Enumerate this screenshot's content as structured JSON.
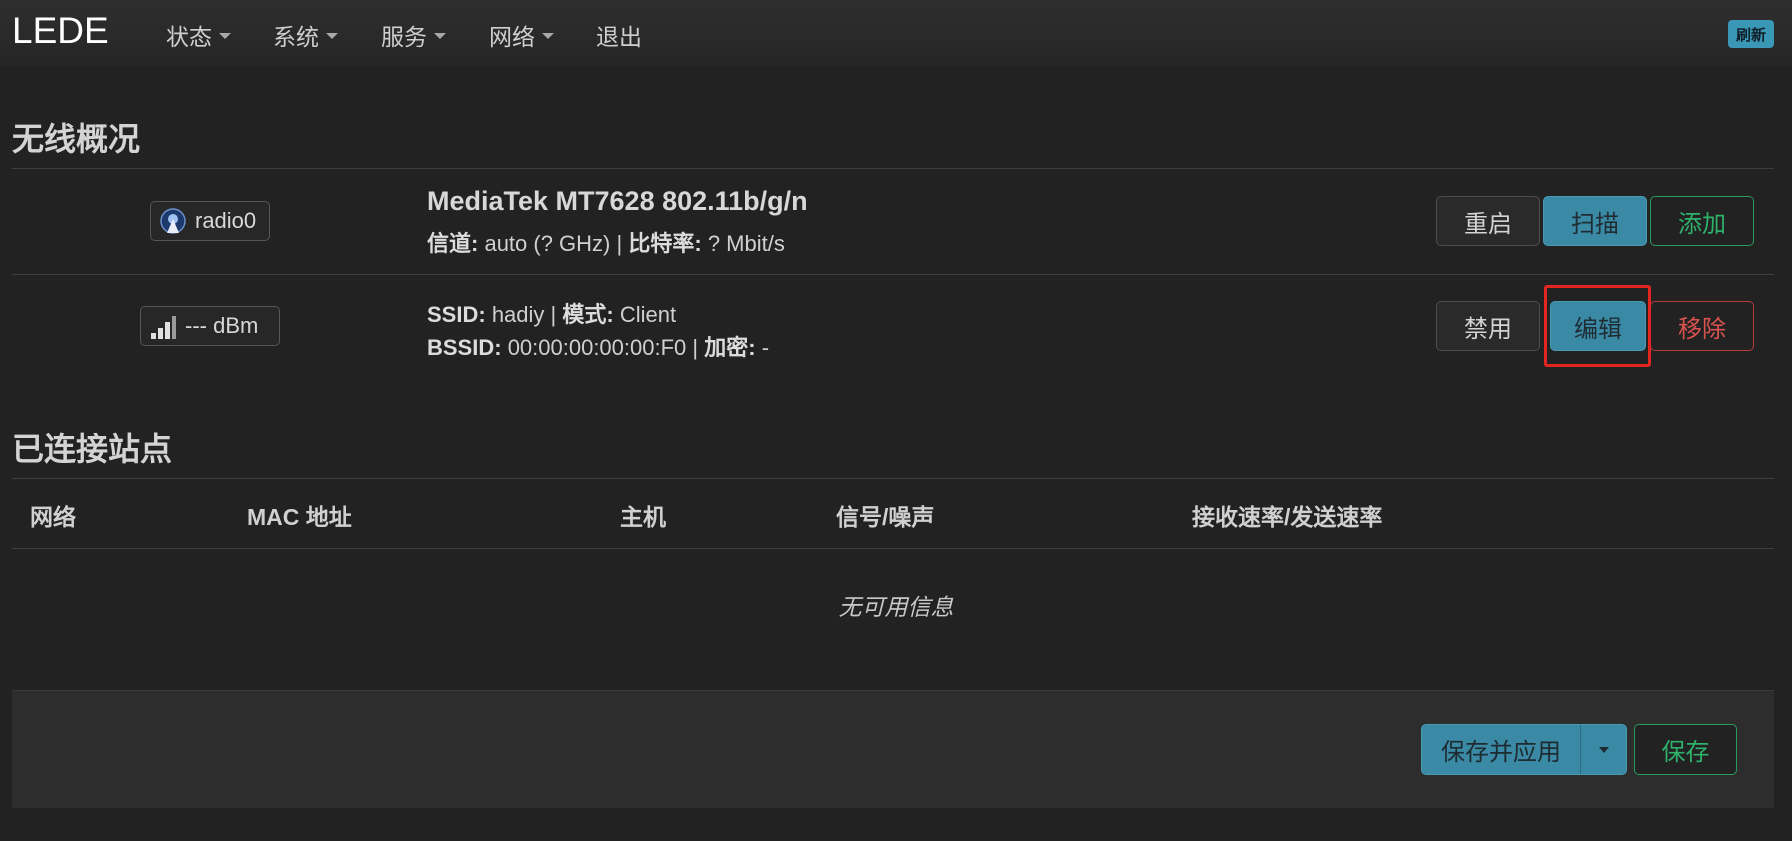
{
  "nav": {
    "brand": "LEDE",
    "items": [
      {
        "label": "状态",
        "dropdown": true
      },
      {
        "label": "系统",
        "dropdown": true
      },
      {
        "label": "服务",
        "dropdown": true
      },
      {
        "label": "网络",
        "dropdown": true
      },
      {
        "label": "退出",
        "dropdown": false
      }
    ],
    "refresh": "刷新"
  },
  "wireless": {
    "title": "无线概况",
    "device": {
      "badge": "radio0",
      "name": "MediaTek MT7628 802.11b/g/n",
      "channel_label": "信道:",
      "channel_value": "auto (? GHz)",
      "sep": "|",
      "bitrate_label": "比特率:",
      "bitrate_value": "? Mbit/s",
      "buttons": {
        "restart": "重启",
        "scan": "扫描",
        "add": "添加"
      }
    },
    "network": {
      "signal": "--- dBm",
      "ssid_label": "SSID:",
      "ssid_value": "hadiy",
      "mode_label": "模式:",
      "mode_value": "Client",
      "bssid_label": "BSSID:",
      "bssid_value": "00:00:00:00:00:F0",
      "enc_label": "加密:",
      "enc_value": "-",
      "sep": "|",
      "buttons": {
        "disable": "禁用",
        "edit": "编辑",
        "remove": "移除"
      }
    }
  },
  "stations": {
    "title": "已连接站点",
    "headers": [
      "网络",
      "MAC 地址",
      "主机",
      "信号/噪声",
      "接收速率/发送速率"
    ],
    "empty": "无可用信息"
  },
  "footer": {
    "save_apply": "保存并应用",
    "save": "保存"
  },
  "colors": {
    "accent": "#3a8aa5",
    "success": "#2fb06b",
    "danger": "#d9534f",
    "highlight": "#e5251f"
  }
}
